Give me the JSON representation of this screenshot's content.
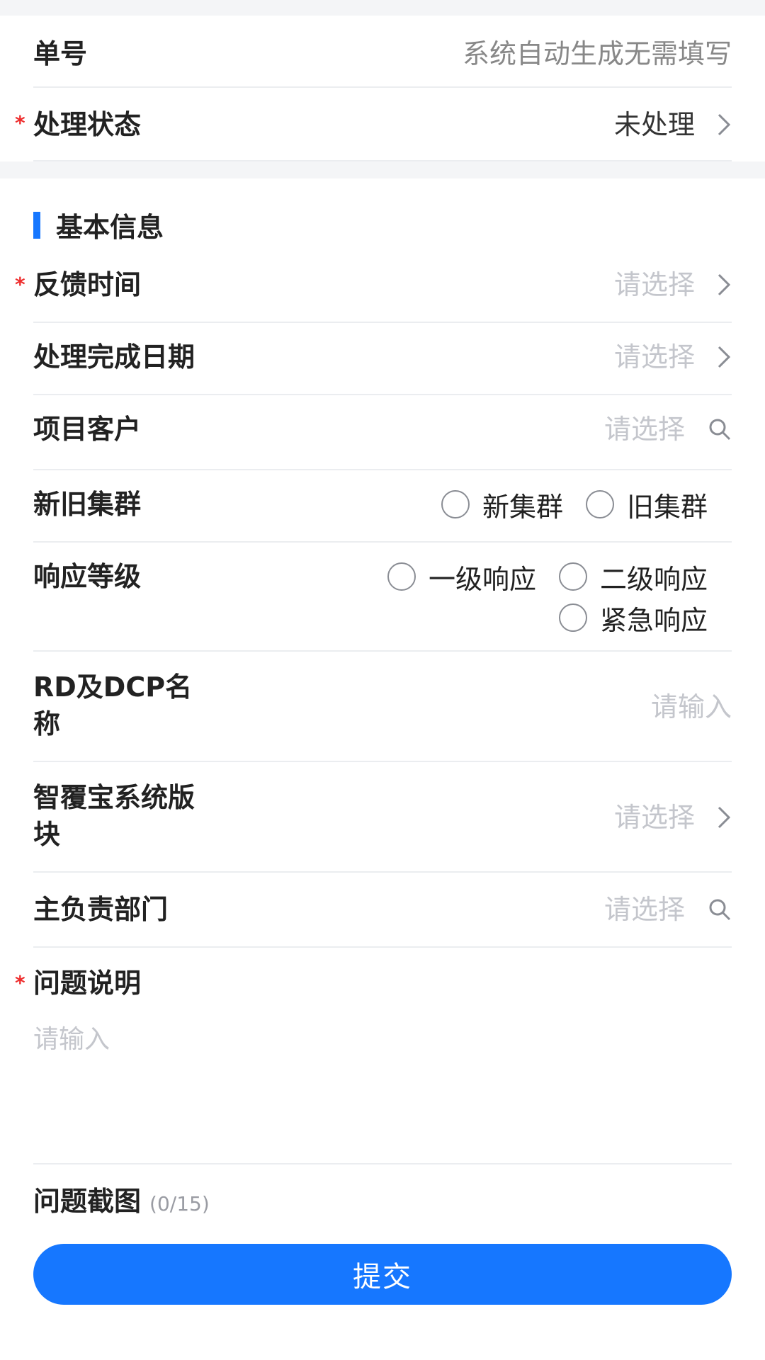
{
  "header": {
    "order_no": {
      "label": "单号",
      "value": "系统自动生成无需填写"
    },
    "status": {
      "required": "*",
      "label": "处理状态",
      "value": "未处理"
    }
  },
  "basic_info": {
    "title": "基本信息",
    "feedback_time": {
      "required": "*",
      "label": "反馈时间",
      "placeholder": "请选择"
    },
    "finish_date": {
      "label": "处理完成日期",
      "placeholder": "请选择"
    },
    "project_customer": {
      "label": "项目客户",
      "placeholder": "请选择"
    },
    "cluster": {
      "label": "新旧集群",
      "options": [
        "新集群",
        "旧集群"
      ]
    },
    "response_level": {
      "label": "响应等级",
      "options": [
        "一级响应",
        "二级响应",
        "紧急响应"
      ]
    },
    "rd_dcp": {
      "label_line1": "RD及DCP名",
      "label_line2": "称",
      "placeholder": "请输入"
    },
    "system_module": {
      "label_line1": "智覆宝系统版",
      "label_line2": "块",
      "placeholder": "请选择"
    },
    "department": {
      "label": "主负责部门",
      "placeholder": "请选择"
    },
    "problem_desc": {
      "required": "*",
      "label": "问题说明",
      "placeholder": "请输入"
    },
    "screenshot": {
      "label": "问题截图",
      "count": "(0/15)"
    }
  },
  "submit": {
    "label": "提交"
  },
  "colors": {
    "accent": "#1677ff",
    "required": "#ee2c2c",
    "placeholder": "#c4c6cc"
  }
}
